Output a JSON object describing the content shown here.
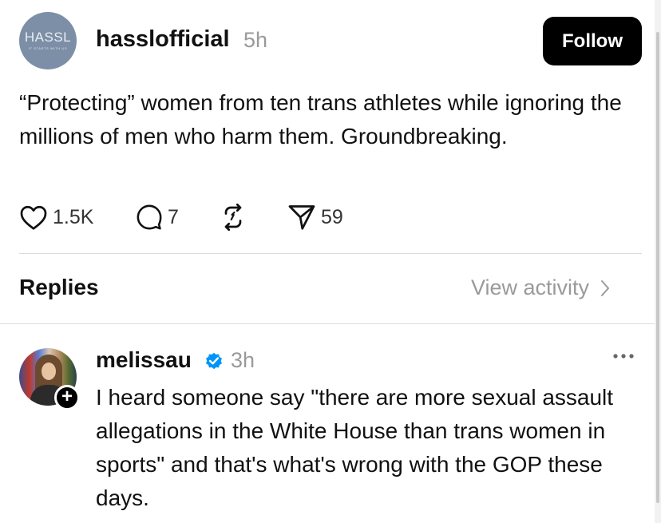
{
  "post": {
    "avatar": {
      "logo_text": "HASSL",
      "logo_tagline": "IT STARTS WITH US"
    },
    "username": "hasslofficial",
    "time": "5h",
    "follow_label": "Follow",
    "text": "“Protecting” women from ten trans athletes while ignoring the millions of men who harm them. Groundbreaking.",
    "actions": {
      "likes": "1.5K",
      "comments": "7",
      "shares": "59",
      "icons": [
        "heart-icon",
        "comment-icon",
        "repost-icon",
        "share-icon"
      ]
    }
  },
  "replies_section": {
    "title": "Replies",
    "view_activity": "View activity"
  },
  "reply": {
    "username": "melissau",
    "verified": true,
    "time": "3h",
    "text": "I heard someone say \"there are more sexual assault allegations in the White House than trans women in sports\" and that's what's wrong with the GOP these days."
  },
  "colors": {
    "follow_button_bg": "#000000",
    "muted_text": "#9a9a9a",
    "verified_blue": "#0095f6",
    "divider": "#dcdcdc"
  }
}
